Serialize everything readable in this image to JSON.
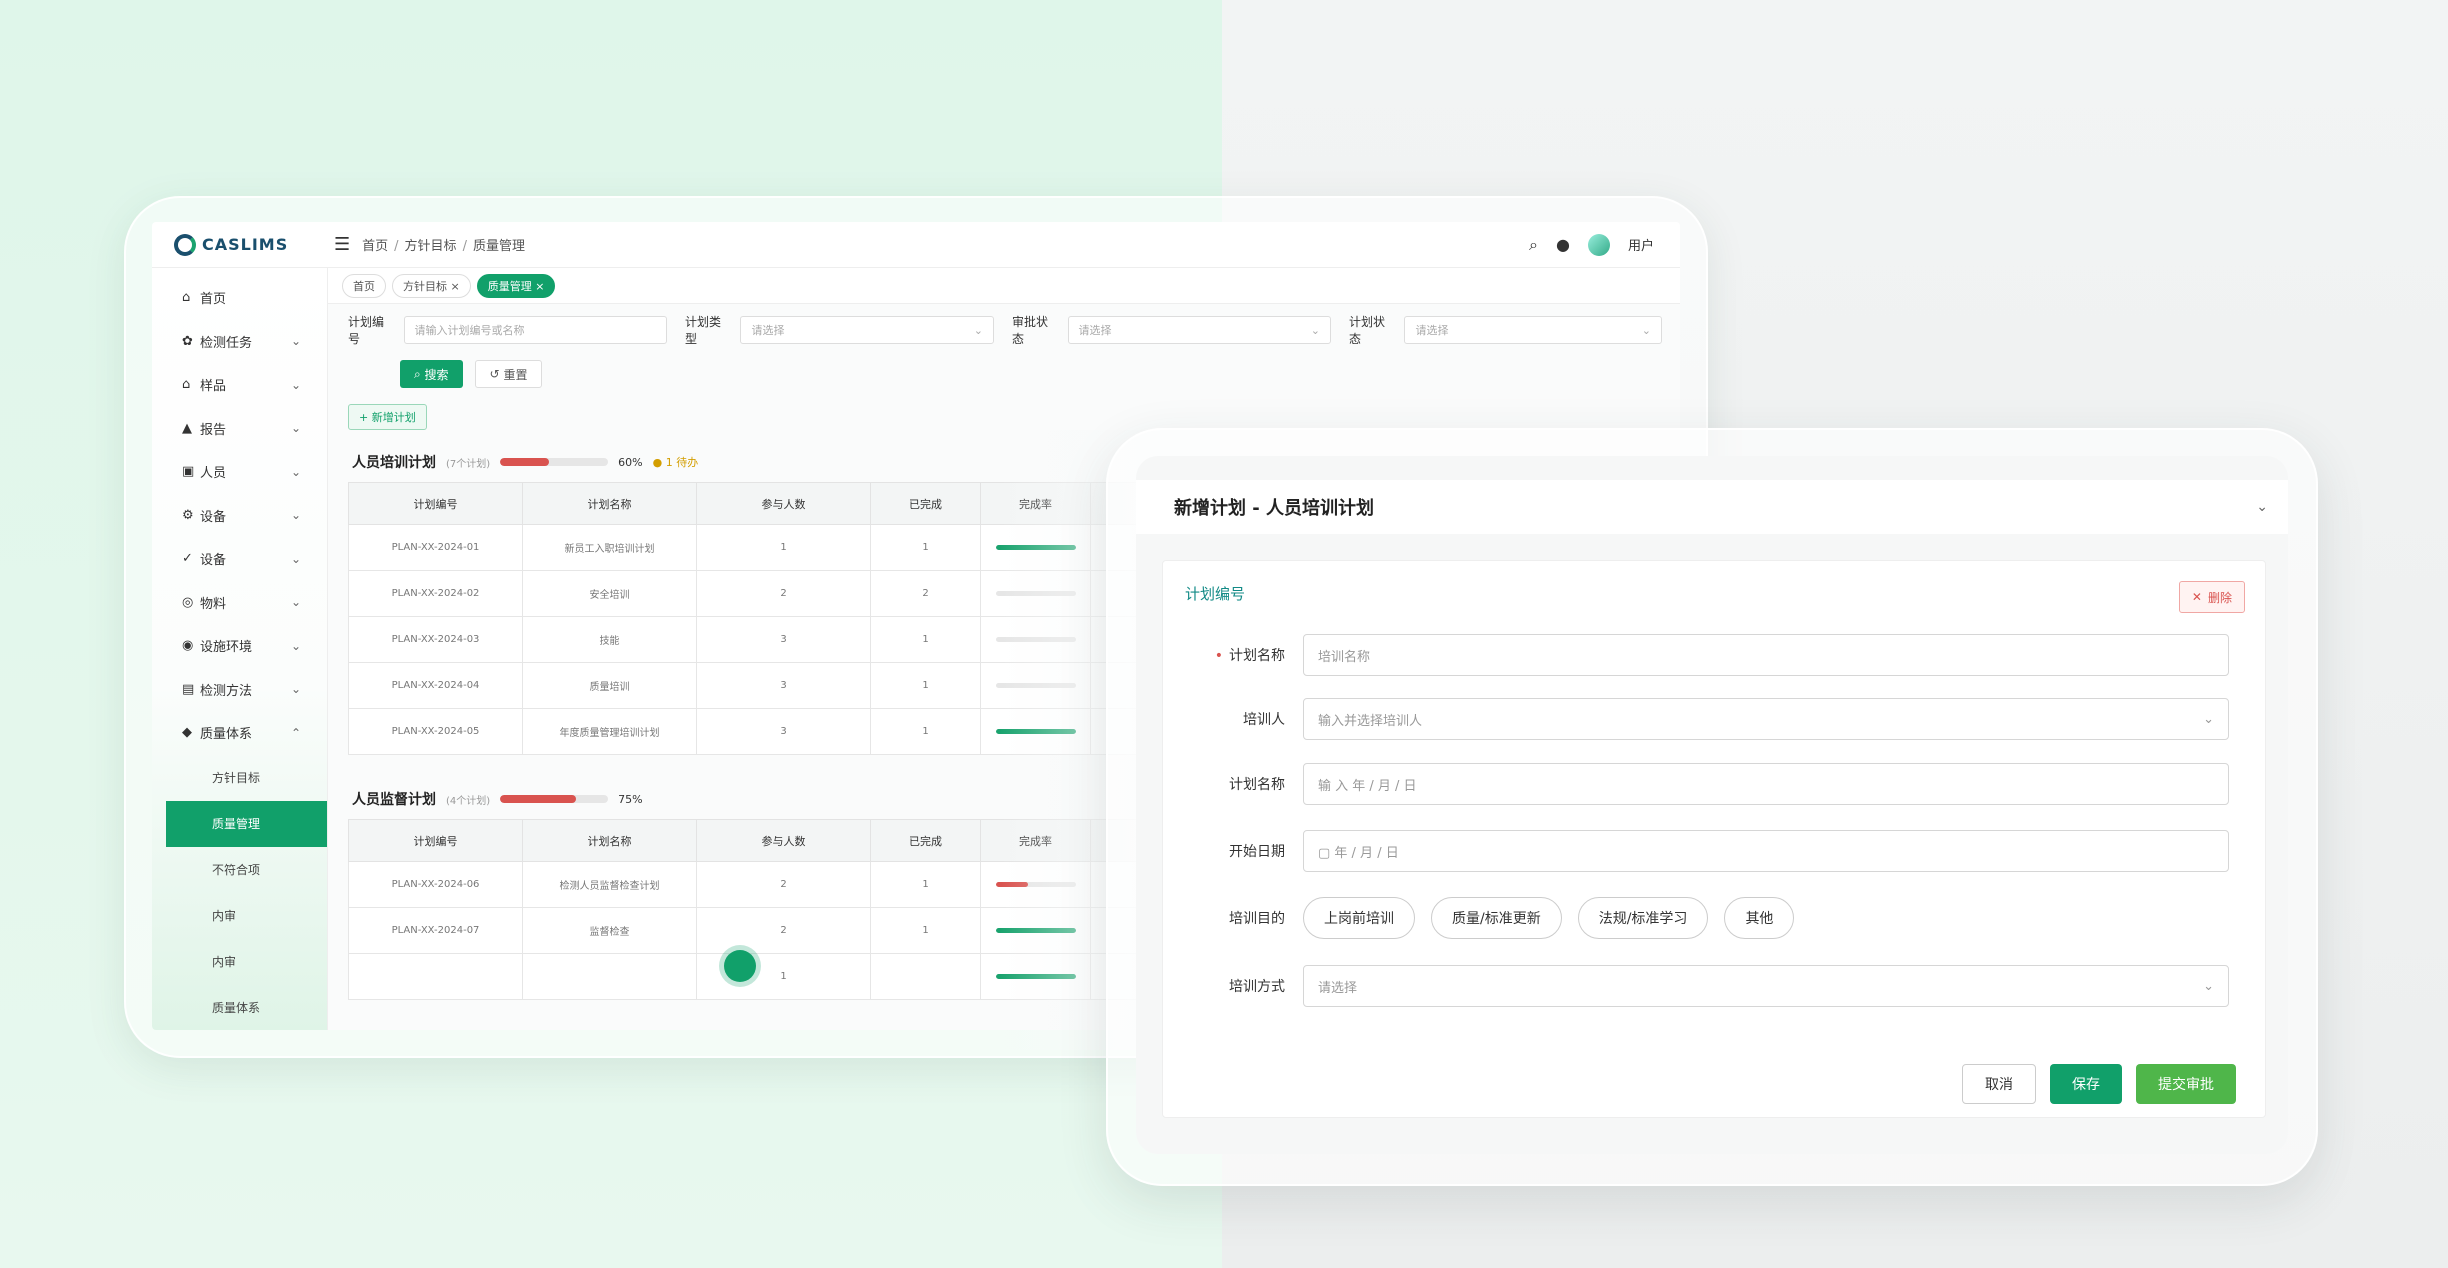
{
  "app": {
    "logo": "CASLIMS",
    "breadcrumb": [
      "首页",
      "方针目标",
      "质量管理"
    ],
    "user": "用户"
  },
  "sidebar": {
    "items": [
      {
        "icon": "home-icon",
        "label": "首页",
        "chevron": ""
      },
      {
        "icon": "task-icon",
        "label": "检测任务",
        "chevron": "⌄"
      },
      {
        "icon": "sample-icon",
        "label": "样品",
        "chevron": "⌄"
      },
      {
        "icon": "report-icon",
        "label": "报告",
        "chevron": "⌄"
      },
      {
        "icon": "people-icon",
        "label": "人员",
        "chevron": "⌄"
      },
      {
        "icon": "equipment-icon",
        "label": "设备",
        "chevron": "⌄"
      },
      {
        "icon": "check-icon",
        "label": "设备",
        "chevron": "⌄"
      },
      {
        "icon": "material-icon",
        "label": "物料",
        "chevron": "⌄"
      },
      {
        "icon": "env-icon",
        "label": "设施环境",
        "chevron": "⌄"
      },
      {
        "icon": "method-icon",
        "label": "检测方法",
        "chevron": "⌄"
      },
      {
        "icon": "shield-icon",
        "label": "质量体系",
        "chevron": "⌃"
      }
    ],
    "subitems": [
      "方针目标",
      "质量管理",
      "不符合项",
      "内审",
      "内审",
      "质量体系"
    ]
  },
  "tabs": [
    "首页",
    "方针目标 ×",
    "质量管理 ×"
  ],
  "filters": [
    {
      "label": "计划编号",
      "placeholder": "请输入计划编号或名称"
    },
    {
      "label": "计划类型",
      "placeholder": "请选择"
    },
    {
      "label": "审批状态",
      "placeholder": "请选择"
    },
    {
      "label": "计划状态",
      "placeholder": "请选择"
    }
  ],
  "buttons": {
    "search": "搜索",
    "reset": "重置",
    "add": "+ 新增计划"
  },
  "sections": [
    {
      "title": "人员培训计划",
      "sub": "(7个计划)",
      "percent": "60%",
      "progress": 0.45,
      "warn": "● 1 待办",
      "headers": [
        "计划编号",
        "计划名称",
        "参与人数",
        "已完成",
        "完成率"
      ],
      "rows": [
        {
          "no": "PLAN-XX-2024-01",
          "name": "新员工入职培训计划",
          "people": "1",
          "done": "1",
          "rate": 1.0,
          "color": "#1aa36e"
        },
        {
          "no": "PLAN-XX-2024-02",
          "name": "安全培训",
          "people": "2",
          "done": "2",
          "rate": 0.0,
          "color": "#1aa36e"
        },
        {
          "no": "PLAN-XX-2024-03",
          "name": "技能",
          "people": "3",
          "done": "1",
          "rate": 0.0,
          "color": "#1aa36e"
        },
        {
          "no": "PLAN-XX-2024-04",
          "name": "质量培训",
          "people": "3",
          "done": "1",
          "rate": 0.0,
          "color": "#1aa36e"
        },
        {
          "no": "PLAN-XX-2024-05",
          "name": "年度质量管理培训计划",
          "people": "3",
          "done": "1",
          "rate": 1.0,
          "color": "#1aa36e"
        }
      ]
    },
    {
      "title": "人员监督计划",
      "sub": "(4个计划)",
      "percent": "75%",
      "progress": 0.7,
      "warn": "",
      "headers": [
        "计划编号",
        "计划名称",
        "参与人数",
        "已完成",
        "完成率"
      ],
      "rows": [
        {
          "no": "PLAN-XX-2024-06",
          "name": "检测人员监督检查计划",
          "people": "2",
          "done": "1",
          "rate": 0.4,
          "color": "#d9534f"
        },
        {
          "no": "PLAN-XX-2024-07",
          "name": "监督检查",
          "people": "2",
          "done": "1",
          "rate": 1.0,
          "color": "#1aa36e"
        },
        {
          "no": "",
          "name": "",
          "people": "1",
          "done": "",
          "rate": 1.0,
          "color": "#1aa36e"
        }
      ]
    }
  ],
  "modal": {
    "title": "新增计划 - 人员培训计划",
    "plan_no_label": "计划编号",
    "delete": "删除",
    "fields": [
      {
        "label": "计划名称",
        "required": true,
        "placeholder": "培训名称",
        "chevron": ""
      },
      {
        "label": "培训人",
        "required": false,
        "placeholder": "输入并选择培训人",
        "chevron": "⌄"
      },
      {
        "label": "计划名称",
        "required": false,
        "placeholder": "输 入 年 / 月 / 日",
        "chevron": ""
      },
      {
        "label": "开始日期",
        "required": false,
        "placeholder": "▢  年 / 月 / 日",
        "chevron": ""
      }
    ],
    "purpose_label": "培训目的",
    "purpose_options": [
      "上岗前培训",
      "质量/标准更新",
      "法规/标准学习",
      "其他"
    ],
    "method_label": "培训方式",
    "method_placeholder": "请选择",
    "cancel": "取消",
    "save": "保存",
    "submit": "提交审批"
  },
  "colors": {
    "primary": "#11a06a",
    "danger": "#d9534f",
    "accent": "#4fb64a"
  }
}
